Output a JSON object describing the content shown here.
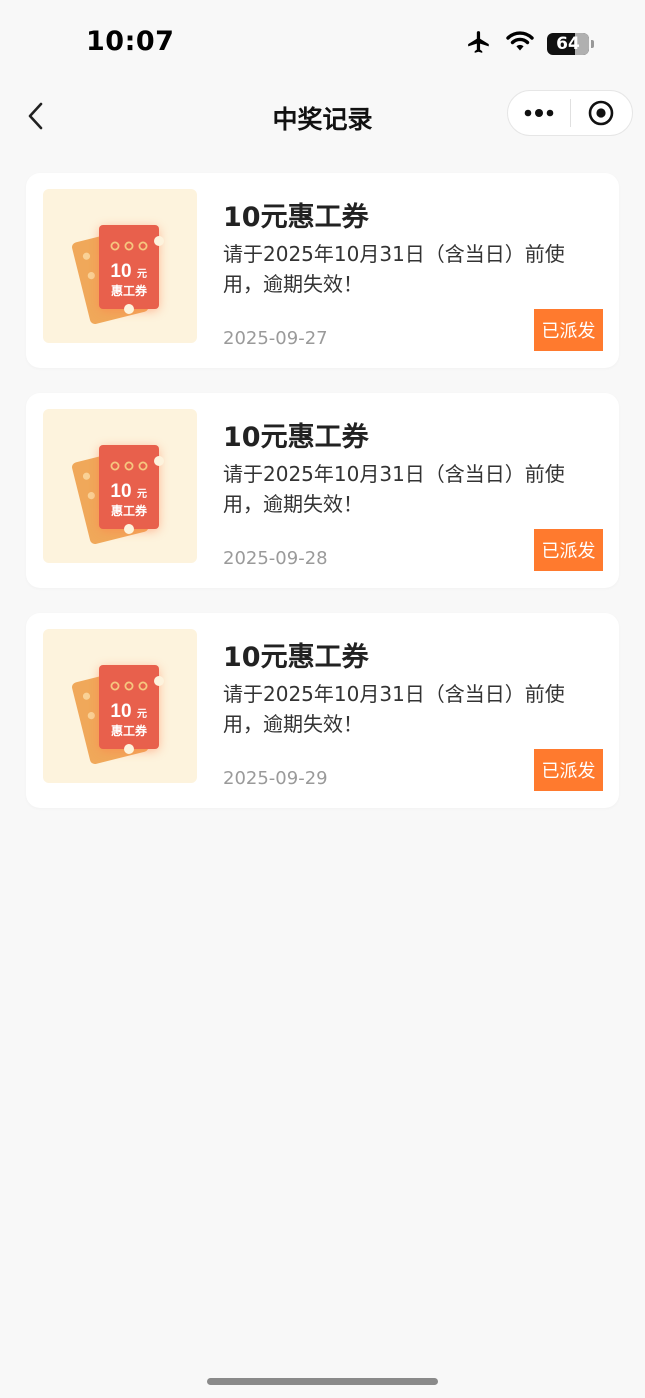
{
  "status_bar": {
    "time": "10:07",
    "battery": "64",
    "icons": [
      "airplane-icon",
      "wifi-icon",
      "battery-icon"
    ]
  },
  "nav": {
    "title": "中奖记录",
    "back_icon": "chevron-left-icon",
    "more_icon": "more-dots-icon",
    "close_icon": "target-circle-icon"
  },
  "records": [
    {
      "title": "10元惠工券",
      "description": "请于2025年10月31日（含当日）前使用，逾期失效！",
      "date": "2025-09-27",
      "status": "已派发",
      "voucher_amount": "10",
      "voucher_unit": "元",
      "voucher_label": "惠工券"
    },
    {
      "title": "10元惠工券",
      "description": "请于2025年10月31日（含当日）前使用，逾期失效！",
      "date": "2025-09-28",
      "status": "已派发",
      "voucher_amount": "10",
      "voucher_unit": "元",
      "voucher_label": "惠工券"
    },
    {
      "title": "10元惠工券",
      "description": "请于2025年10月31日（含当日）前使用，逾期失效！",
      "date": "2025-09-29",
      "status": "已派发",
      "voucher_amount": "10",
      "voucher_unit": "元",
      "voucher_label": "惠工券"
    }
  ],
  "colors": {
    "accent": "#ff7a2e",
    "voucher_red": "#e8604c",
    "voucher_orange": "#f0a85a",
    "thumb_bg": "#fdf3dd",
    "page_bg": "#f8f8f8"
  }
}
